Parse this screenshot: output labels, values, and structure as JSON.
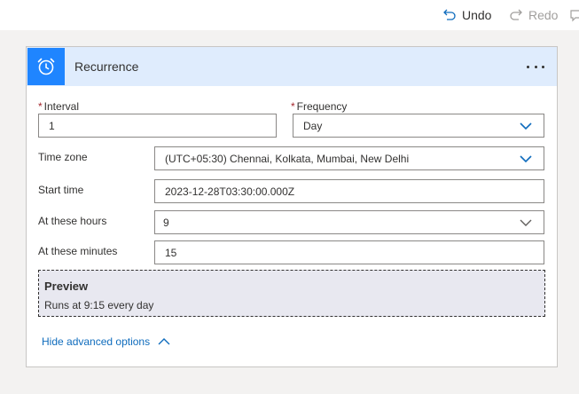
{
  "toolbar": {
    "undo_label": "Undo",
    "redo_label": "Redo"
  },
  "card": {
    "title": "Recurrence",
    "header_color": "#dfecfd",
    "icon_bg": "#1f85ff",
    "icon": "alarm-clock-icon"
  },
  "form": {
    "required_mark": "*",
    "interval_label": "Interval",
    "interval_value": "1",
    "frequency_label": "Frequency",
    "frequency_value": "Day",
    "timezone_label": "Time zone",
    "timezone_value": "(UTC+05:30) Chennai, Kolkata, Mumbai, New Delhi",
    "start_label": "Start time",
    "start_value": "2023-12-28T03:30:00.000Z",
    "hours_label": "At these hours",
    "hours_value": "9",
    "minutes_label": "At these minutes",
    "minutes_value": "15"
  },
  "preview": {
    "title": "Preview",
    "text": "Runs at 9:15 every day"
  },
  "advanced": {
    "label": "Hide advanced options"
  },
  "colors": {
    "accent": "#0f6cbd",
    "required": "#a4262c"
  }
}
